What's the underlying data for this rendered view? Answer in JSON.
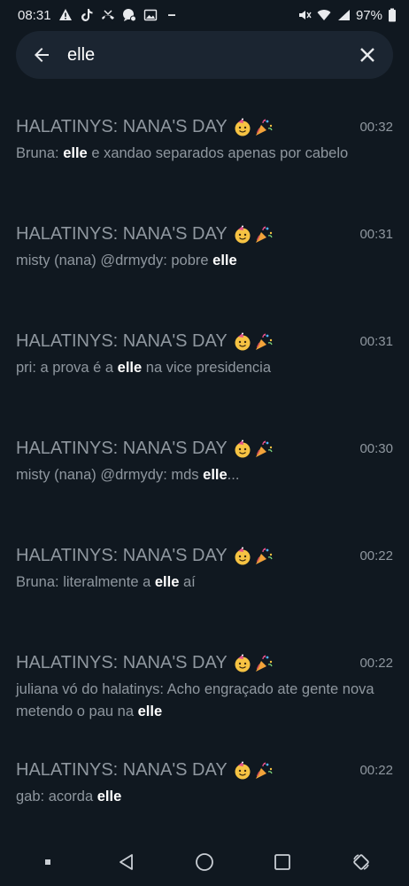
{
  "status_bar": {
    "time": "08:31",
    "battery": "97%",
    "icons": [
      "warning-icon",
      "tiktok-icon",
      "missed-call-icon",
      "chat-bubble-icon",
      "image-icon",
      "minus-icon",
      "mute-icon",
      "wifi-icon",
      "signal-icon",
      "battery-icon"
    ]
  },
  "search": {
    "value": "elle",
    "back_icon": "arrow-left-icon",
    "clear_icon": "close-icon"
  },
  "results": [
    {
      "title": "HALATINYS: NANA'S DAY",
      "time": "00:32",
      "sender": "Bruna: ",
      "highlight": "elle",
      "after": " e xandao separados apenas por cabelo",
      "before": ""
    },
    {
      "title": "HALATINYS: NANA'S DAY",
      "time": "00:31",
      "sender": "misty (nana) @drmydy: ",
      "before": "pobre ",
      "highlight": "elle",
      "after": ""
    },
    {
      "title": "HALATINYS: NANA'S DAY",
      "time": "00:31",
      "sender": "pri: ",
      "before": "a prova é a ",
      "highlight": "elle",
      "after": " na vice presidencia"
    },
    {
      "title": "HALATINYS: NANA'S DAY",
      "time": "00:30",
      "sender": "misty (nana) @drmydy: ",
      "before": "mds ",
      "highlight": "elle",
      "after": "..."
    },
    {
      "title": "HALATINYS: NANA'S DAY",
      "time": "00:22",
      "sender": "Bruna: ",
      "before": "literalmente a ",
      "highlight": "elle",
      "after": " aí"
    },
    {
      "title": "HALATINYS: NANA'S DAY",
      "time": "00:22",
      "sender": "juliana vó do halatinys: ",
      "before": "Acho engraçado ate gente nova metendo o pau na ",
      "highlight": "elle",
      "after": ""
    },
    {
      "title": "HALATINYS: NANA'S DAY",
      "time": "00:22",
      "sender": "gab: ",
      "before": "acorda ",
      "highlight": "elle",
      "after": ""
    }
  ],
  "nav_bar": {
    "icons": [
      "recents-dot-icon",
      "back-triangle-icon",
      "home-circle-icon",
      "overview-square-icon",
      "rotate-icon"
    ]
  }
}
